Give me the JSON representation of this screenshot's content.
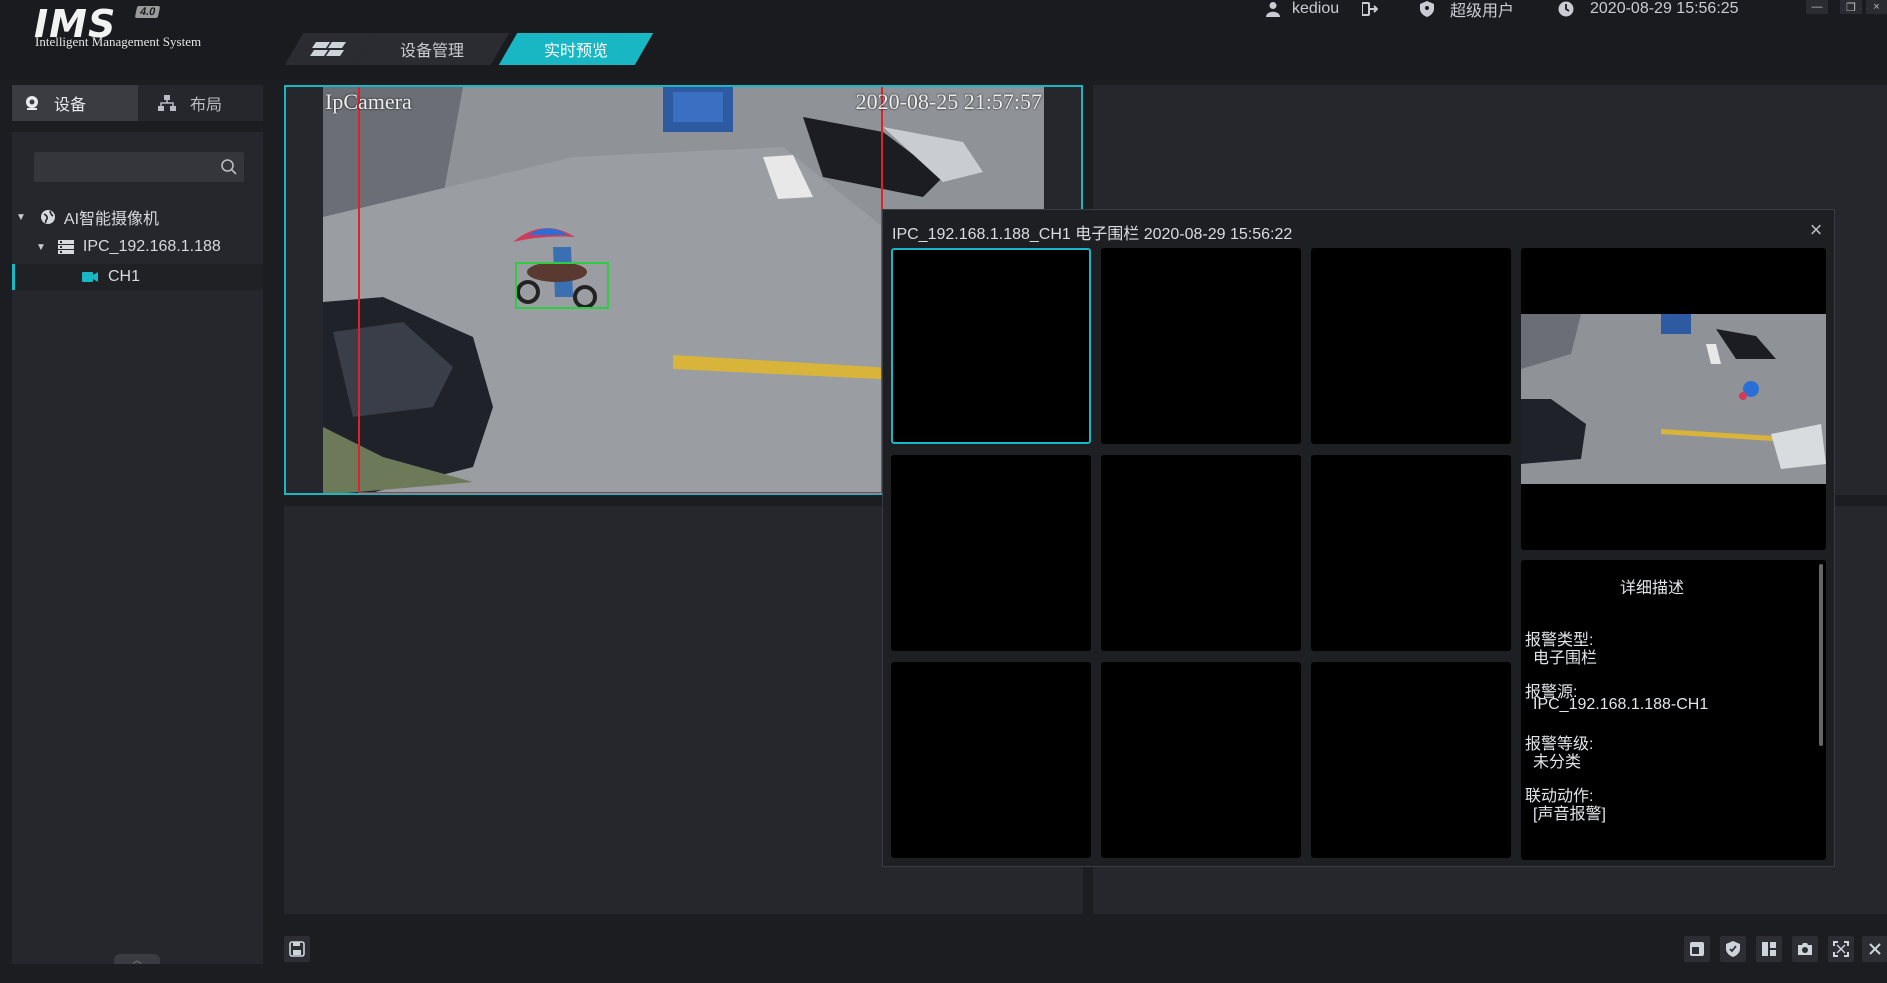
{
  "header": {
    "logo": "IMS",
    "version": "4.0",
    "subtitle": "Intelligent Management System",
    "tabs": [
      {
        "label": "设备管理"
      },
      {
        "label": "实时预览"
      }
    ],
    "user": "kediou",
    "role": "超级用户",
    "datetime": "2020-08-29 15:56:25"
  },
  "sidebar": {
    "tabs": [
      {
        "label": "设备",
        "icon": "webcam-icon"
      },
      {
        "label": "布局",
        "icon": "layout-tree-icon"
      }
    ],
    "search_placeholder": "",
    "tree": [
      {
        "label": "AI智能摄像机",
        "level": 0,
        "icon": "globe-icon"
      },
      {
        "label": "IPC_192.168.1.188",
        "level": 1,
        "icon": "server-icon"
      },
      {
        "label": "CH1",
        "level": 2,
        "icon": "camera-icon"
      }
    ]
  },
  "camera": {
    "osd_name": "IpCamera",
    "osd_time": "2020-08-25 21:57:57"
  },
  "alarm_popup": {
    "title": "IPC_192.168.1.188_CH1  电子围栏  2020-08-29 15:56:22",
    "description_title": "详细描述",
    "fields": [
      {
        "label": "报警类型:",
        "value": "电子围栏"
      },
      {
        "label": "报警源:",
        "value": "IPC_192.168.1.188-CH1"
      },
      {
        "label": "报警等级:",
        "value": "未分类"
      },
      {
        "label": "联动动作:",
        "value": "[声音报警]"
      }
    ]
  },
  "colors": {
    "accent": "#19b6c4",
    "background": "#1c1d21",
    "panel": "#25272c",
    "fence_line": "#e0202a",
    "detect_box": "#2ecc40"
  }
}
